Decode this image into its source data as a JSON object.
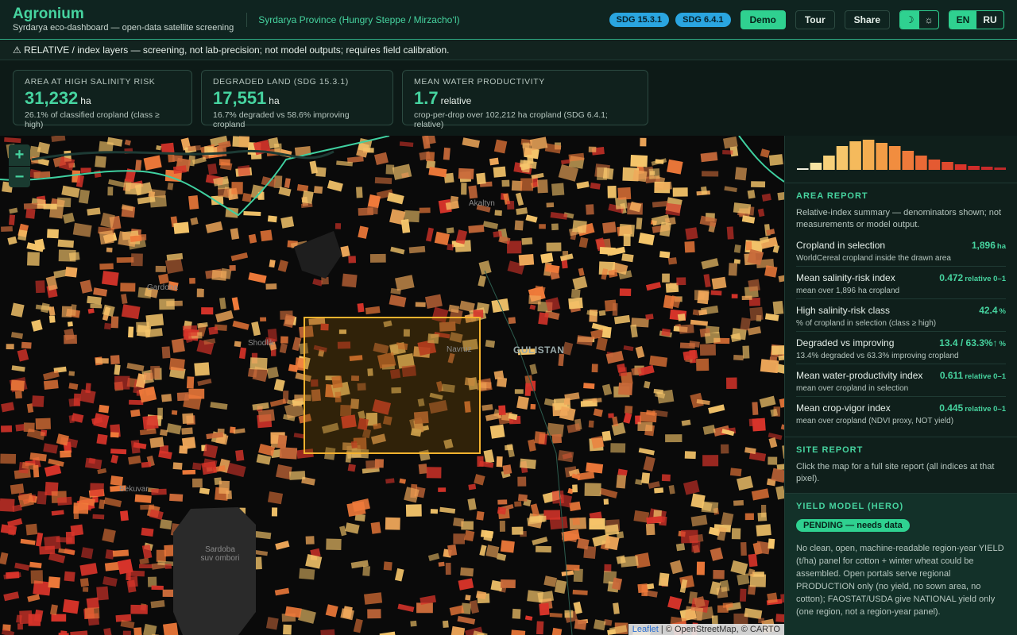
{
  "header": {
    "title": "Agronium",
    "subtitle": "Syrdarya eco-dashboard — open-data satellite screening",
    "region": "Syrdarya Province (Hungry Steppe / Mirzacho‘l)",
    "sdg_badges": [
      "SDG 15.3.1",
      "SDG 6.4.1"
    ],
    "demo": "Demo",
    "tour": "Tour",
    "share": "Share",
    "theme_dark": "☽",
    "theme_light": "☼",
    "lang_en": "EN",
    "lang_ru": "RU"
  },
  "warning": "⚠ RELATIVE / index layers — screening, not lab-precision; not model outputs; requires field calibration.",
  "kpis": [
    {
      "label": "AREA AT HIGH SALINITY RISK",
      "value": "31,232",
      "unit": "ha",
      "note": "26.1% of classified cropland (class ≥ high)"
    },
    {
      "label": "DEGRADED LAND (SDG 15.3.1)",
      "value": "17,551",
      "unit": "ha",
      "note": "16.7% degraded vs 58.6% improving cropland"
    },
    {
      "label": "MEAN WATER PRODUCTIVITY",
      "value": "1.7",
      "unit": "relative",
      "note": "crop-per-drop over 102,212 ha cropland (SDG 6.4.1; relative)"
    }
  ],
  "map": {
    "zoom_in": "+",
    "zoom_out": "−",
    "places": {
      "akaltyn": "Akaltyn",
      "gardoba": "Gardoba",
      "shodlik": "Shodlik",
      "navruz": "Navruz",
      "gulistan": "GULISTAN",
      "bekuvar": "Bekuvar",
      "sardoba": "Sardoba suv ombori"
    },
    "attribution_leaflet": "Leaflet",
    "attribution_rest": " | © OpenStreetMap, © CARTO",
    "colors": {
      "low": "#f6c66b",
      "mid": "#ef7a3a",
      "high": "#d8342a",
      "selection": "#f5b32f"
    }
  },
  "histogram": [
    2,
    9,
    18,
    30,
    36,
    38,
    34,
    30,
    24,
    18,
    13,
    10,
    7,
    5,
    4,
    3
  ],
  "area_report": {
    "title": "AREA REPORT",
    "note": "Relative-index summary — denominators shown; not measurements or model output.",
    "rows": [
      {
        "label": "Cropland in selection",
        "value": "1,896",
        "unit": "ha",
        "sub": "WorldCereal cropland inside the drawn area"
      },
      {
        "label": "Mean salinity-risk index",
        "value": "0.472",
        "unit": "relative 0–1",
        "sub": "mean over 1,896 ha cropland"
      },
      {
        "label": "High salinity-risk class",
        "value": "42.4",
        "unit": "%",
        "sub": "% of cropland in selection (class ≥ high)"
      },
      {
        "label": "Degraded vs improving",
        "value": "13.4 / 63.3%↑",
        "unit": "%",
        "sub": "13.4% degraded vs 63.3% improving cropland"
      },
      {
        "label": "Mean water-productivity index",
        "value": "0.611",
        "unit": "relative 0–1",
        "sub": "mean over cropland in selection"
      },
      {
        "label": "Mean crop-vigor index",
        "value": "0.445",
        "unit": "relative 0–1",
        "sub": "mean over cropland (NDVI proxy, NOT yield)"
      }
    ]
  },
  "site_report": {
    "title": "SITE REPORT",
    "note": "Click the map for a full site report (all indices at that pixel)."
  },
  "yield_model": {
    "title": "YIELD MODEL (HERO)",
    "badge": "PENDING — needs data",
    "text": "No clean, open, machine-readable region-year YIELD (t/ha) panel for cotton + winter wheat could be assembled. Open portals serve regional PRODUCTION only (no yield, no sown area, no cotton); FAOSTAT/USDA give NATIONAL yield only (one region, not a region-year panel)."
  }
}
